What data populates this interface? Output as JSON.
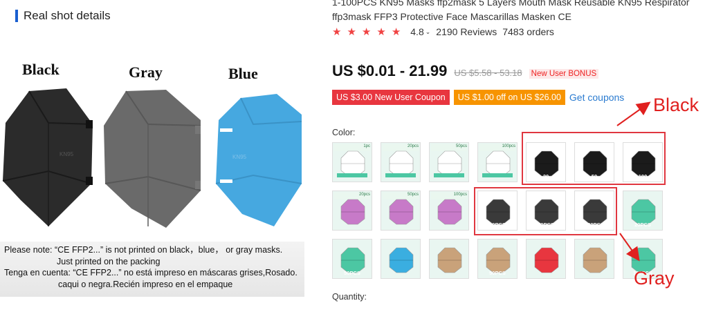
{
  "left": {
    "section_title": "Real shot details",
    "color_labels": [
      "Black",
      "Gray",
      "Blue"
    ],
    "mask_text": [
      "KN95",
      "KN95"
    ],
    "note_lines": [
      "Please note: “CE FFP2...” is not printed on black，blue， or gray masks.",
      "Just printed on the packing",
      "Tenga en cuenta: “CE FFP2...” no está impreso en máscaras grises,Rosado.",
      "caqui o negra.Recién impreso en el empaque"
    ]
  },
  "product": {
    "title_line1": "1-100PCS KN95 Masks ffp2mask 5 Layers Mouth Mask Reusable KN95 Respirator",
    "title_line2": "ffp3mask FFP3 Protective Face Mascarillas Masken CE",
    "rating": "4.8",
    "reviews": "2190 Reviews",
    "orders": "7483 orders",
    "price": "US $0.01 - 21.99",
    "old_price": "US $5.58 - 53.18",
    "bonus": "New User BONUS",
    "coupons": [
      "US $3.00 New User Coupon",
      "US $1.00 off on US $26.00"
    ],
    "get_coupons": "Get coupons",
    "color_title": "Color:",
    "quantity_title": "Quantity:"
  },
  "sku_options": [
    {
      "tone": "#ffffff",
      "tag": "1pc",
      "label": ""
    },
    {
      "tone": "#ffffff",
      "tag": "20pcs",
      "label": ""
    },
    {
      "tone": "#ffffff",
      "tag": "50pcs",
      "label": ""
    },
    {
      "tone": "#ffffff",
      "tag": "100pcs",
      "label": ""
    },
    {
      "tone": "#1b1b1b",
      "tag": "",
      "label": "20"
    },
    {
      "tone": "#1b1b1b",
      "tag": "",
      "label": "50"
    },
    {
      "tone": "#1b1b1b",
      "tag": "",
      "label": "100"
    },
    {
      "tone": "#c77ac8",
      "tag": "20pcs",
      "label": ""
    },
    {
      "tone": "#c77ac8",
      "tag": "50pcs",
      "label": ""
    },
    {
      "tone": "#c77ac8",
      "tag": "100pcs",
      "label": ""
    },
    {
      "tone": "#3a3a3a",
      "tag": "",
      "label": "20PCS"
    },
    {
      "tone": "#3a3a3a",
      "tag": "",
      "label": "50PCS"
    },
    {
      "tone": "#3a3a3a",
      "tag": "",
      "label": "100PCS"
    },
    {
      "tone": "#4cc7a3",
      "tag": "",
      "label": "20PCS"
    },
    {
      "tone": "#4cc7a3",
      "tag": "",
      "label": "50PCS"
    },
    {
      "tone": "#3aaee0",
      "tag": "",
      "label": ""
    },
    {
      "tone": "#c9a27a",
      "tag": "",
      "label": ""
    },
    {
      "tone": "#c9a27a",
      "tag": "",
      "label": "50PCS"
    },
    {
      "tone": "#e8363f",
      "tag": "",
      "label": ""
    },
    {
      "tone": "#c9a27a",
      "tag": "",
      "label": ""
    },
    {
      "tone": "#4cc7a3",
      "tag": "",
      "label": "100PCS"
    }
  ],
  "annotations": {
    "black": "Black",
    "gray": "Gray"
  },
  "colors": {
    "accent_red": "#e0363f",
    "link_blue": "#2a7bd0",
    "price_red": "#e22"
  }
}
